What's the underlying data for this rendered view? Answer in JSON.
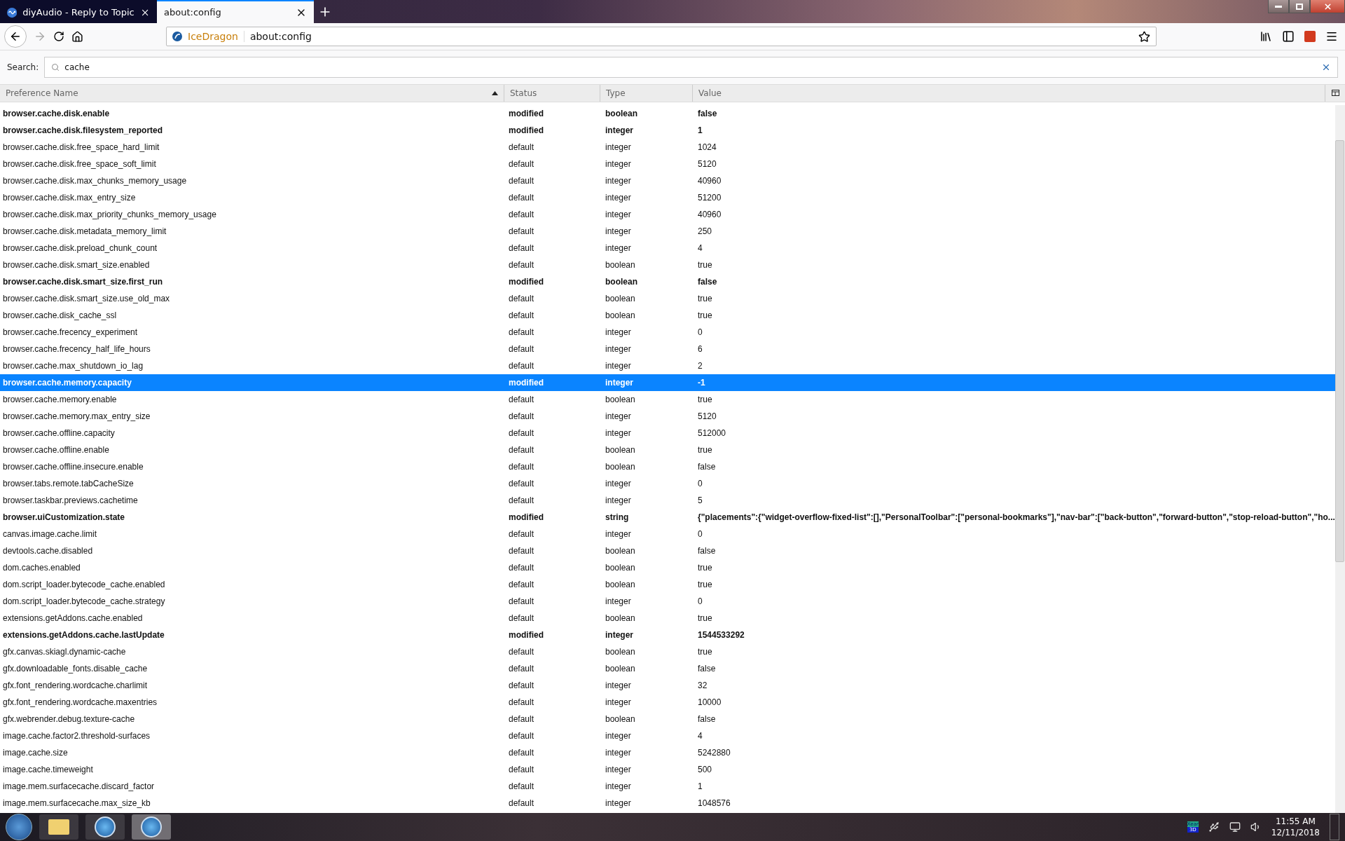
{
  "tabs": [
    {
      "title": "diyAudio - Reply to Topic",
      "selected": false
    },
    {
      "title": "about:config",
      "selected": true
    }
  ],
  "address_bar": {
    "identity": "IceDragon",
    "url": "about:config"
  },
  "search": {
    "label": "Search:",
    "value": "cache"
  },
  "table": {
    "columns": [
      {
        "label": "Preference Name",
        "sorted": true
      },
      {
        "label": "Status",
        "sorted": false
      },
      {
        "label": "Type",
        "sorted": false
      },
      {
        "label": "Value",
        "sorted": false
      }
    ],
    "rows": [
      {
        "name": "browser.cache.disk.enable",
        "status": "modified",
        "type": "boolean",
        "value": "false",
        "modified": true,
        "selected": false
      },
      {
        "name": "browser.cache.disk.filesystem_reported",
        "status": "modified",
        "type": "integer",
        "value": "1",
        "modified": true,
        "selected": false
      },
      {
        "name": "browser.cache.disk.free_space_hard_limit",
        "status": "default",
        "type": "integer",
        "value": "1024",
        "modified": false,
        "selected": false
      },
      {
        "name": "browser.cache.disk.free_space_soft_limit",
        "status": "default",
        "type": "integer",
        "value": "5120",
        "modified": false,
        "selected": false
      },
      {
        "name": "browser.cache.disk.max_chunks_memory_usage",
        "status": "default",
        "type": "integer",
        "value": "40960",
        "modified": false,
        "selected": false
      },
      {
        "name": "browser.cache.disk.max_entry_size",
        "status": "default",
        "type": "integer",
        "value": "51200",
        "modified": false,
        "selected": false
      },
      {
        "name": "browser.cache.disk.max_priority_chunks_memory_usage",
        "status": "default",
        "type": "integer",
        "value": "40960",
        "modified": false,
        "selected": false
      },
      {
        "name": "browser.cache.disk.metadata_memory_limit",
        "status": "default",
        "type": "integer",
        "value": "250",
        "modified": false,
        "selected": false
      },
      {
        "name": "browser.cache.disk.preload_chunk_count",
        "status": "default",
        "type": "integer",
        "value": "4",
        "modified": false,
        "selected": false
      },
      {
        "name": "browser.cache.disk.smart_size.enabled",
        "status": "default",
        "type": "boolean",
        "value": "true",
        "modified": false,
        "selected": false
      },
      {
        "name": "browser.cache.disk.smart_size.first_run",
        "status": "modified",
        "type": "boolean",
        "value": "false",
        "modified": true,
        "selected": false
      },
      {
        "name": "browser.cache.disk.smart_size.use_old_max",
        "status": "default",
        "type": "boolean",
        "value": "true",
        "modified": false,
        "selected": false
      },
      {
        "name": "browser.cache.disk_cache_ssl",
        "status": "default",
        "type": "boolean",
        "value": "true",
        "modified": false,
        "selected": false
      },
      {
        "name": "browser.cache.frecency_experiment",
        "status": "default",
        "type": "integer",
        "value": "0",
        "modified": false,
        "selected": false
      },
      {
        "name": "browser.cache.frecency_half_life_hours",
        "status": "default",
        "type": "integer",
        "value": "6",
        "modified": false,
        "selected": false
      },
      {
        "name": "browser.cache.max_shutdown_io_lag",
        "status": "default",
        "type": "integer",
        "value": "2",
        "modified": false,
        "selected": false
      },
      {
        "name": "browser.cache.memory.capacity",
        "status": "modified",
        "type": "integer",
        "value": "-1",
        "modified": true,
        "selected": true
      },
      {
        "name": "browser.cache.memory.enable",
        "status": "default",
        "type": "boolean",
        "value": "true",
        "modified": false,
        "selected": false
      },
      {
        "name": "browser.cache.memory.max_entry_size",
        "status": "default",
        "type": "integer",
        "value": "5120",
        "modified": false,
        "selected": false
      },
      {
        "name": "browser.cache.offline.capacity",
        "status": "default",
        "type": "integer",
        "value": "512000",
        "modified": false,
        "selected": false
      },
      {
        "name": "browser.cache.offline.enable",
        "status": "default",
        "type": "boolean",
        "value": "true",
        "modified": false,
        "selected": false
      },
      {
        "name": "browser.cache.offline.insecure.enable",
        "status": "default",
        "type": "boolean",
        "value": "false",
        "modified": false,
        "selected": false
      },
      {
        "name": "browser.tabs.remote.tabCacheSize",
        "status": "default",
        "type": "integer",
        "value": "0",
        "modified": false,
        "selected": false
      },
      {
        "name": "browser.taskbar.previews.cachetime",
        "status": "default",
        "type": "integer",
        "value": "5",
        "modified": false,
        "selected": false
      },
      {
        "name": "browser.uiCustomization.state",
        "status": "modified",
        "type": "string",
        "value": "{\"placements\":{\"widget-overflow-fixed-list\":[],\"PersonalToolbar\":[\"personal-bookmarks\"],\"nav-bar\":[\"back-button\",\"forward-button\",\"stop-reload-button\",\"ho...",
        "modified": true,
        "selected": false
      },
      {
        "name": "canvas.image.cache.limit",
        "status": "default",
        "type": "integer",
        "value": "0",
        "modified": false,
        "selected": false
      },
      {
        "name": "devtools.cache.disabled",
        "status": "default",
        "type": "boolean",
        "value": "false",
        "modified": false,
        "selected": false
      },
      {
        "name": "dom.caches.enabled",
        "status": "default",
        "type": "boolean",
        "value": "true",
        "modified": false,
        "selected": false
      },
      {
        "name": "dom.script_loader.bytecode_cache.enabled",
        "status": "default",
        "type": "boolean",
        "value": "true",
        "modified": false,
        "selected": false
      },
      {
        "name": "dom.script_loader.bytecode_cache.strategy",
        "status": "default",
        "type": "integer",
        "value": "0",
        "modified": false,
        "selected": false
      },
      {
        "name": "extensions.getAddons.cache.enabled",
        "status": "default",
        "type": "boolean",
        "value": "true",
        "modified": false,
        "selected": false
      },
      {
        "name": "extensions.getAddons.cache.lastUpdate",
        "status": "modified",
        "type": "integer",
        "value": "1544533292",
        "modified": true,
        "selected": false
      },
      {
        "name": "gfx.canvas.skiagl.dynamic-cache",
        "status": "default",
        "type": "boolean",
        "value": "true",
        "modified": false,
        "selected": false
      },
      {
        "name": "gfx.downloadable_fonts.disable_cache",
        "status": "default",
        "type": "boolean",
        "value": "false",
        "modified": false,
        "selected": false
      },
      {
        "name": "gfx.font_rendering.wordcache.charlimit",
        "status": "default",
        "type": "integer",
        "value": "32",
        "modified": false,
        "selected": false
      },
      {
        "name": "gfx.font_rendering.wordcache.maxentries",
        "status": "default",
        "type": "integer",
        "value": "10000",
        "modified": false,
        "selected": false
      },
      {
        "name": "gfx.webrender.debug.texture-cache",
        "status": "default",
        "type": "boolean",
        "value": "false",
        "modified": false,
        "selected": false
      },
      {
        "name": "image.cache.factor2.threshold-surfaces",
        "status": "default",
        "type": "integer",
        "value": "4",
        "modified": false,
        "selected": false
      },
      {
        "name": "image.cache.size",
        "status": "default",
        "type": "integer",
        "value": "5242880",
        "modified": false,
        "selected": false
      },
      {
        "name": "image.cache.timeweight",
        "status": "default",
        "type": "integer",
        "value": "500",
        "modified": false,
        "selected": false
      },
      {
        "name": "image.mem.surfacecache.discard_factor",
        "status": "default",
        "type": "integer",
        "value": "1",
        "modified": false,
        "selected": false
      },
      {
        "name": "image.mem.surfacecache.max_size_kb",
        "status": "default",
        "type": "integer",
        "value": "1048576",
        "modified": false,
        "selected": false
      }
    ]
  },
  "taskbar": {
    "time": "11:55 AM",
    "date": "12/11/2018",
    "tray_label": "Xear",
    "tray_badge": "3D"
  }
}
